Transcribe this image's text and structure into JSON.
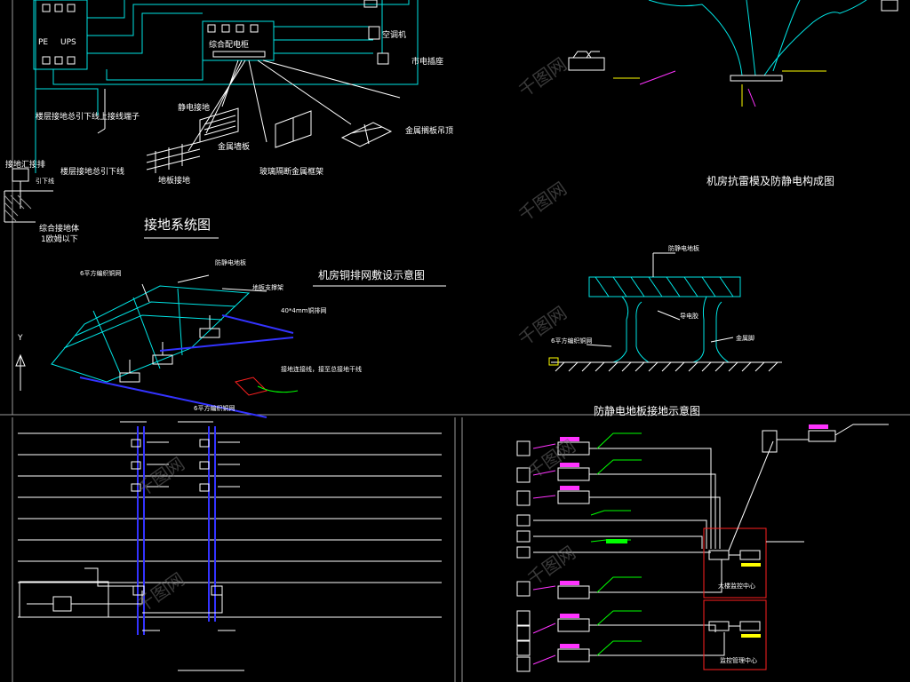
{
  "colors": {
    "background": "#000000",
    "cyan": "#00e5e5",
    "white": "#ffffff",
    "green": "#00ff00",
    "magenta": "#ff33ff",
    "blue": "#3333ff",
    "red": "#ff2020",
    "yellow": "#ffff00"
  },
  "grounding_system": {
    "title": "接地系统图",
    "labels": {
      "pe": "PE",
      "ups": "UPS",
      "distribution_cabinet": "综合配电柜",
      "air_conditioner": "空调机",
      "mains_socket": "市电插座",
      "static_ground": "静电接地",
      "metal_wall_panel": "金属墙板",
      "glass_partition": "玻璃隔断金属框架",
      "metal_ceiling": "金属搁板吊顶",
      "floor_ground": "地板接地",
      "upper_floor_bond": "楼层接地总引下线上接线端子",
      "lower_floor_bond": "楼层接地总引下线",
      "ground_bus": "接地汇接排",
      "down_lead": "引下线",
      "ground_body": "综合接地体",
      "ground_body_resistance": "1欧姆以下"
    }
  },
  "copper_mesh": {
    "title": "机房铜排网敷设示意图",
    "labels": {
      "mesh_top": "6平方编织铜网",
      "antistatic_floor": "防静电地板",
      "floor_support": "地板支撑架",
      "copper_strip": "40*4mm铜排网",
      "connection": "接地连接线，接至总接地干线",
      "mesh_bottom": "6平方编织铜网",
      "axis_y": "Y"
    }
  },
  "lightning": {
    "title": "机房抗雷模及防静电构成图"
  },
  "antistatic_floor": {
    "title": "防静电地板接地示意图",
    "labels": {
      "floor_board": "防静电地板",
      "conductor": "导电胶",
      "mesh": "6平方编织铜网",
      "metal_foot": "金属脚"
    }
  },
  "lower_right": {
    "labels": {
      "center_one": "大楼监控中心",
      "center_two": "监控管理中心"
    }
  },
  "watermark": {
    "text": "千图网"
  }
}
